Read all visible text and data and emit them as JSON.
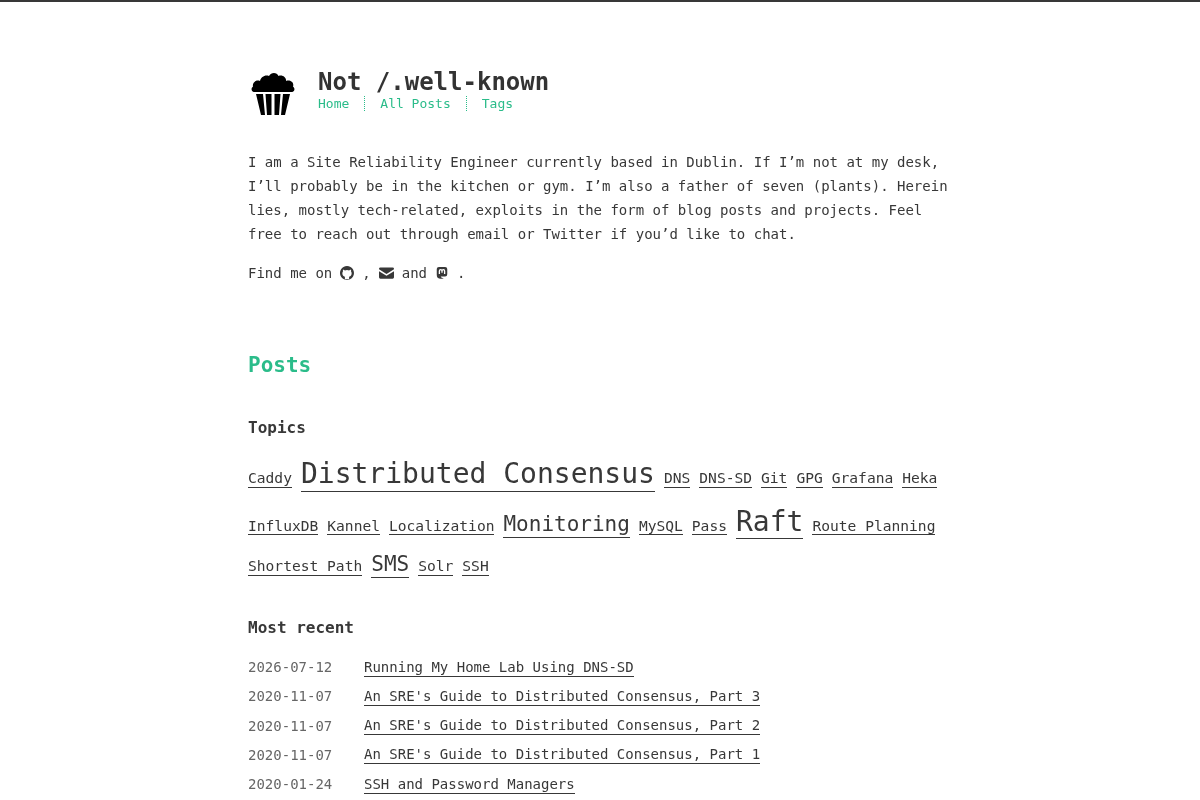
{
  "site": {
    "title": "Not /.well-known",
    "nav": [
      {
        "label": "Home"
      },
      {
        "label": "All Posts"
      },
      {
        "label": "Tags"
      }
    ]
  },
  "about": {
    "paragraph": "I am a Site Reliability Engineer currently based in Dublin. If I’m not at my desk, I’ll probably be in the kitchen or gym. I’m also a father of seven (plants). Herein lies, mostly tech-related, exploits in the form of blog posts and projects. Feel free to reach out through email or Twitter if you’d like to chat.",
    "find_me": {
      "lead": "Find me on",
      "separator": ",",
      "conjunction": "and",
      "end": "."
    }
  },
  "posts": {
    "heading": "Posts",
    "topics": {
      "heading": "Topics",
      "tags": [
        {
          "label": "Caddy",
          "kind": "small"
        },
        {
          "label": "Distributed Consensus",
          "kind": "large"
        },
        {
          "label": "DNS",
          "kind": "small"
        },
        {
          "label": "DNS-SD",
          "kind": "small"
        },
        {
          "label": "Git",
          "kind": "small"
        },
        {
          "label": "GPG",
          "kind": "small"
        },
        {
          "label": "Grafana",
          "kind": "small"
        },
        {
          "label": "Heka",
          "kind": "small"
        },
        {
          "label": "InfluxDB",
          "kind": "small"
        },
        {
          "label": "Kannel",
          "kind": "small"
        },
        {
          "label": "Localization",
          "kind": "small"
        },
        {
          "label": "Monitoring",
          "kind": "medium"
        },
        {
          "label": "MySQL",
          "kind": "small"
        },
        {
          "label": "Pass",
          "kind": "small"
        },
        {
          "label": "Raft",
          "kind": "large"
        },
        {
          "label": "Route Planning",
          "kind": "small"
        },
        {
          "label": "Shortest Path",
          "kind": "small"
        },
        {
          "label": "SMS",
          "kind": "medium"
        },
        {
          "label": "Solr",
          "kind": "small"
        },
        {
          "label": "SSH",
          "kind": "small"
        }
      ]
    },
    "recent": {
      "heading": "Most recent",
      "items": [
        {
          "date": "2026-07-12",
          "title": "Running My Home Lab Using DNS-SD"
        },
        {
          "date": "2020-11-07",
          "title": "An SRE's Guide to Distributed Consensus, Part 3"
        },
        {
          "date": "2020-11-07",
          "title": "An SRE's Guide to Distributed Consensus, Part 2"
        },
        {
          "date": "2020-11-07",
          "title": "An SRE's Guide to Distributed Consensus, Part 1"
        },
        {
          "date": "2020-01-24",
          "title": "SSH and Password Managers"
        }
      ]
    }
  }
}
